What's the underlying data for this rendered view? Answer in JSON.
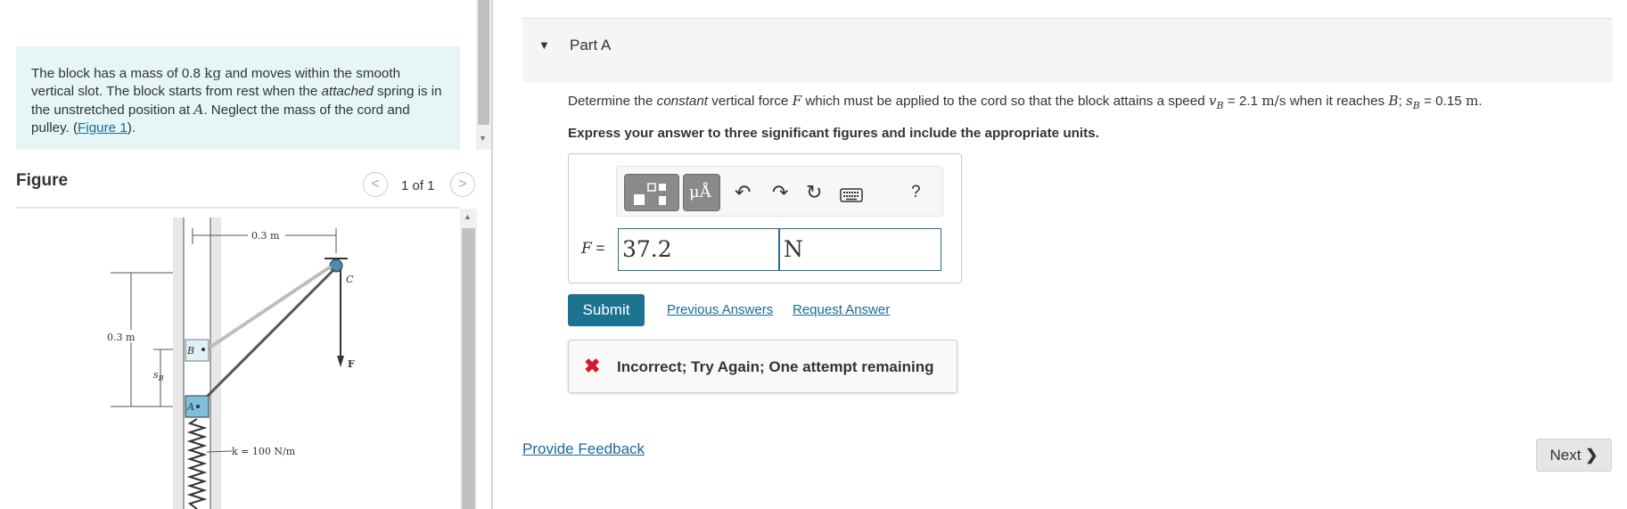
{
  "problem": {
    "t1": "The block has a mass of 0.8 ",
    "kg": "kg",
    "t2": " and moves within the smooth vertical slot. The block starts from rest when the ",
    "attached": "attached",
    "t3": " spring is in the unstretched position at ",
    "A": "A",
    "t4": ". Neglect the mass of the cord and pulley. (",
    "figure_link": "Figure 1",
    "t5": ")."
  },
  "figure": {
    "title": "Figure",
    "counter": "1 of 1",
    "prev_icon": "chevron-left-icon",
    "next_icon": "chevron-right-icon",
    "labels": {
      "top_dim": "0.3 m",
      "left_dim": "0.3 m",
      "c": "C",
      "b": "B",
      "a": "A",
      "sb": "s",
      "sb_sub": "B",
      "f": "F",
      "spring": "k = 100 N/m"
    }
  },
  "part": {
    "label": "Part A",
    "caret_icon": "caret-down-icon"
  },
  "question": {
    "t1": "Determine the ",
    "constant": "constant",
    "t2": " vertical force ",
    "F": "F",
    "t3": " which must be applied to the cord so that the block attains a speed ",
    "vB": "v",
    "vB_sub": "B",
    "t4": " = 2.1 ",
    "units1": "m/s",
    "t5": " when it reaches ",
    "B": "B",
    "t6": "; ",
    "sB": "s",
    "sB_sub": "B",
    "t7": " = 0.15 ",
    "units2": "m",
    "t8": "."
  },
  "instruction": "Express your answer to three significant figures and include the appropriate units.",
  "toolbar": {
    "units_label": "μÅ",
    "undo_icon": "undo-icon",
    "redo_icon": "redo-icon",
    "reset_icon": "reset-icon",
    "keyboard_icon": "keyboard-icon",
    "help": "?"
  },
  "answer": {
    "label": "F",
    "equals": " =",
    "value": "37.2",
    "units": "N"
  },
  "actions": {
    "submit": "Submit",
    "previous_answers": "Previous Answers",
    "request_answer": "Request Answer"
  },
  "feedback": {
    "icon": "x-icon",
    "text": "Incorrect; Try Again; One attempt remaining"
  },
  "footer": {
    "provide_feedback": "Provide Feedback",
    "next": "Next"
  },
  "colors": {
    "accent": "#1b7390",
    "link": "#1a6b96",
    "error": "#d11a2a",
    "problem_bg": "#e6f5f5"
  }
}
